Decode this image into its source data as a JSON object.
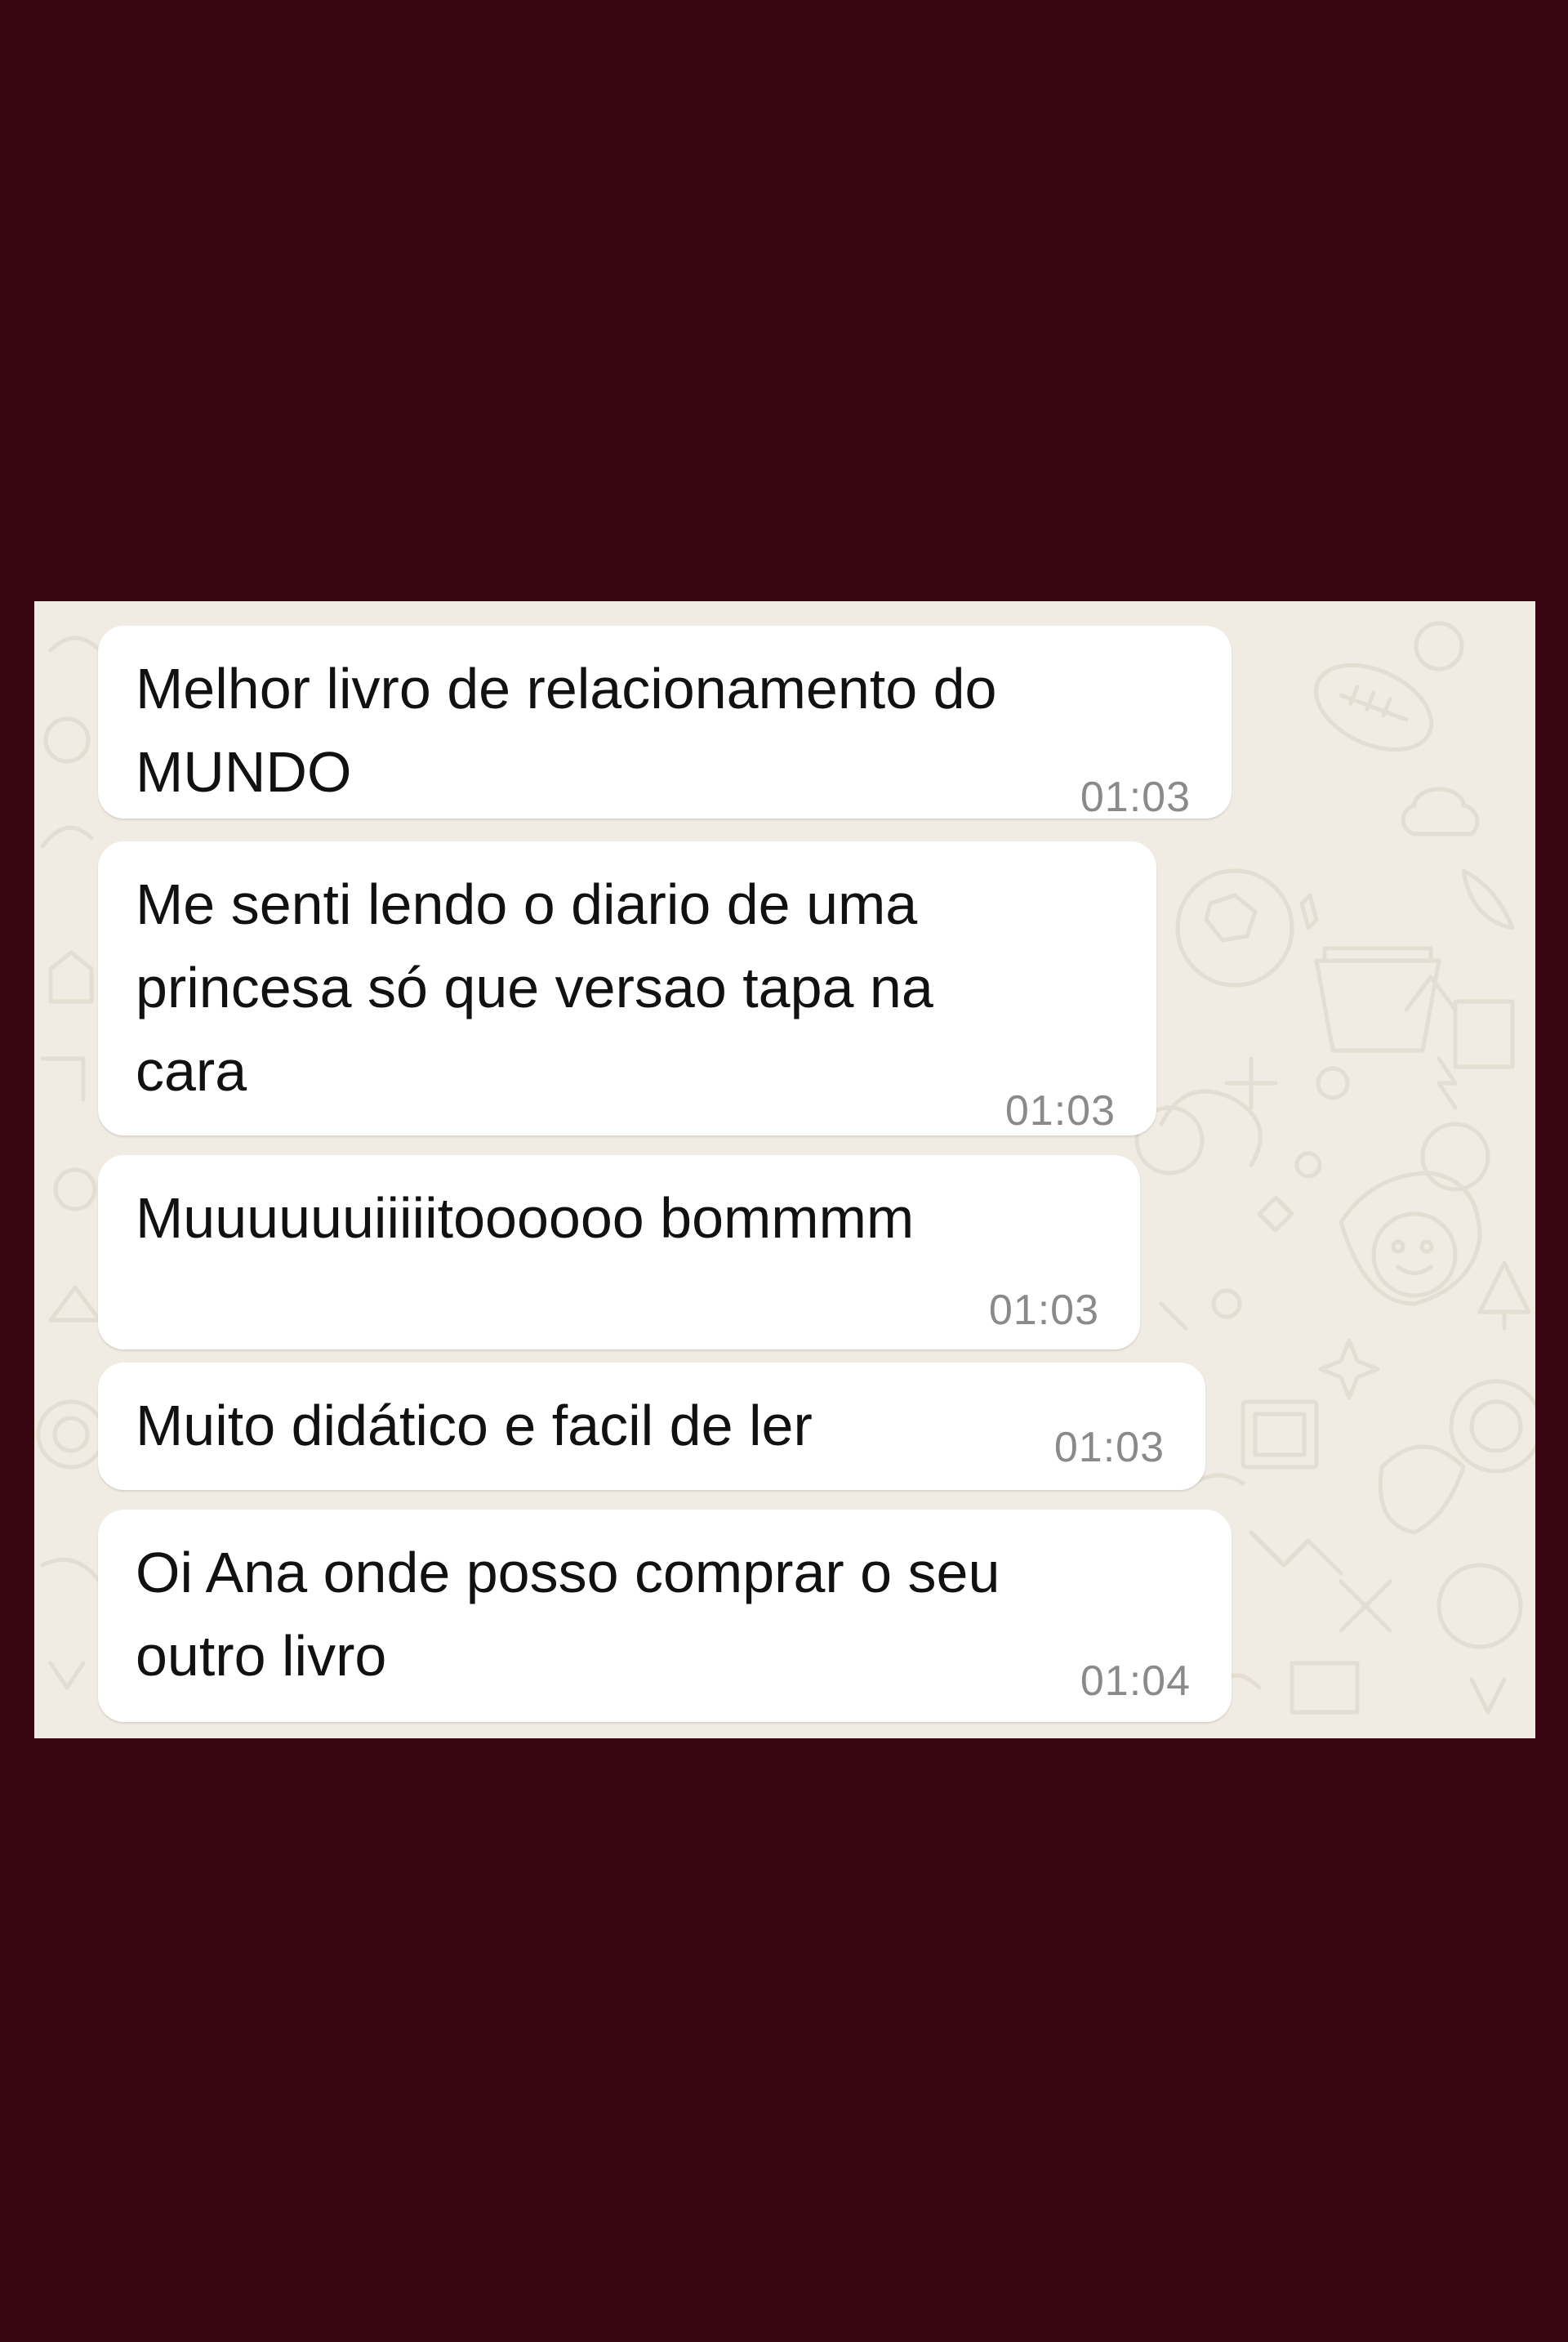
{
  "chat": {
    "messages": [
      {
        "text": "Melhor livro de relacionamento do\nMUNDO",
        "time": "01:03"
      },
      {
        "text": "Me senti lendo o diario de uma\nprincesa só que versao tapa na\ncara",
        "time": "01:03"
      },
      {
        "text": "Muuuuuuiiiiitoooooo bommmm",
        "time": "01:03"
      },
      {
        "text": "Muito didático e facil de ler",
        "time": "01:03"
      },
      {
        "text": "Oi Ana onde posso comprar o seu\noutro livro",
        "time": "01:04"
      }
    ]
  },
  "colors": {
    "outer_background": "#370410",
    "chat_wallpaper": "#f0ebe3",
    "bubble": "#ffffff",
    "timestamp": "#8a8a8a"
  }
}
